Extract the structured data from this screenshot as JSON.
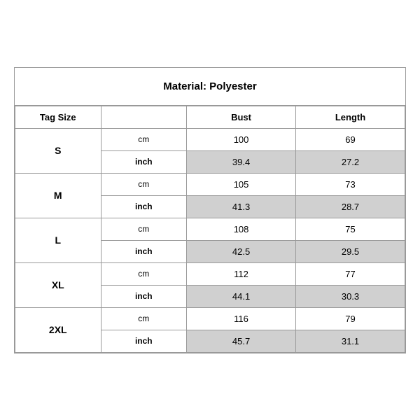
{
  "title": "Material: Polyester",
  "headers": {
    "tag_size": "Tag Size",
    "bust": "Bust",
    "length": "Length"
  },
  "sizes": [
    {
      "label": "S",
      "rows": [
        {
          "unit": "cm",
          "bust": "100",
          "length": "69",
          "shaded": false
        },
        {
          "unit": "inch",
          "bust": "39.4",
          "length": "27.2",
          "shaded": true
        }
      ]
    },
    {
      "label": "M",
      "rows": [
        {
          "unit": "cm",
          "bust": "105",
          "length": "73",
          "shaded": false
        },
        {
          "unit": "inch",
          "bust": "41.3",
          "length": "28.7",
          "shaded": true
        }
      ]
    },
    {
      "label": "L",
      "rows": [
        {
          "unit": "cm",
          "bust": "108",
          "length": "75",
          "shaded": false
        },
        {
          "unit": "inch",
          "bust": "42.5",
          "length": "29.5",
          "shaded": true
        }
      ]
    },
    {
      "label": "XL",
      "rows": [
        {
          "unit": "cm",
          "bust": "112",
          "length": "77",
          "shaded": false
        },
        {
          "unit": "inch",
          "bust": "44.1",
          "length": "30.3",
          "shaded": true
        }
      ]
    },
    {
      "label": "2XL",
      "rows": [
        {
          "unit": "cm",
          "bust": "116",
          "length": "79",
          "shaded": false
        },
        {
          "unit": "inch",
          "bust": "45.7",
          "length": "31.1",
          "shaded": true
        }
      ]
    }
  ]
}
